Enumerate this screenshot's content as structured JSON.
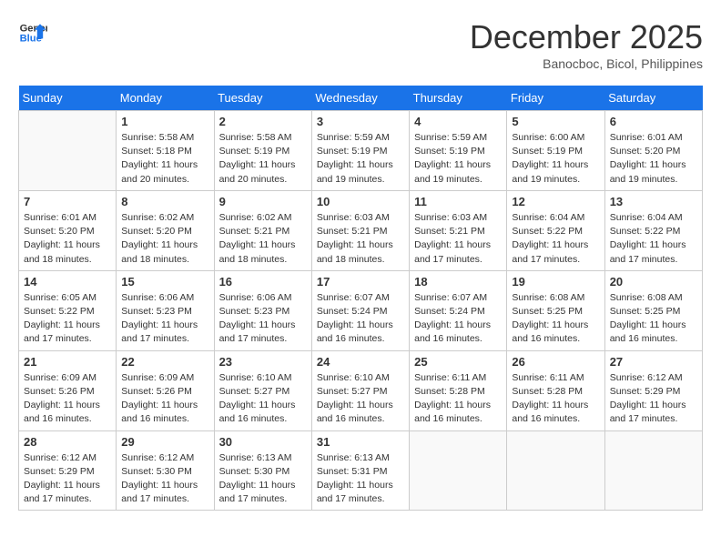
{
  "header": {
    "logo_line1": "General",
    "logo_line2": "Blue",
    "month": "December 2025",
    "location": "Banocboc, Bicol, Philippines"
  },
  "days_of_week": [
    "Sunday",
    "Monday",
    "Tuesday",
    "Wednesday",
    "Thursday",
    "Friday",
    "Saturday"
  ],
  "weeks": [
    [
      {
        "day": "",
        "info": ""
      },
      {
        "day": "1",
        "info": "Sunrise: 5:58 AM\nSunset: 5:18 PM\nDaylight: 11 hours\nand 20 minutes."
      },
      {
        "day": "2",
        "info": "Sunrise: 5:58 AM\nSunset: 5:19 PM\nDaylight: 11 hours\nand 20 minutes."
      },
      {
        "day": "3",
        "info": "Sunrise: 5:59 AM\nSunset: 5:19 PM\nDaylight: 11 hours\nand 19 minutes."
      },
      {
        "day": "4",
        "info": "Sunrise: 5:59 AM\nSunset: 5:19 PM\nDaylight: 11 hours\nand 19 minutes."
      },
      {
        "day": "5",
        "info": "Sunrise: 6:00 AM\nSunset: 5:19 PM\nDaylight: 11 hours\nand 19 minutes."
      },
      {
        "day": "6",
        "info": "Sunrise: 6:01 AM\nSunset: 5:20 PM\nDaylight: 11 hours\nand 19 minutes."
      }
    ],
    [
      {
        "day": "7",
        "info": "Sunrise: 6:01 AM\nSunset: 5:20 PM\nDaylight: 11 hours\nand 18 minutes."
      },
      {
        "day": "8",
        "info": "Sunrise: 6:02 AM\nSunset: 5:20 PM\nDaylight: 11 hours\nand 18 minutes."
      },
      {
        "day": "9",
        "info": "Sunrise: 6:02 AM\nSunset: 5:21 PM\nDaylight: 11 hours\nand 18 minutes."
      },
      {
        "day": "10",
        "info": "Sunrise: 6:03 AM\nSunset: 5:21 PM\nDaylight: 11 hours\nand 18 minutes."
      },
      {
        "day": "11",
        "info": "Sunrise: 6:03 AM\nSunset: 5:21 PM\nDaylight: 11 hours\nand 17 minutes."
      },
      {
        "day": "12",
        "info": "Sunrise: 6:04 AM\nSunset: 5:22 PM\nDaylight: 11 hours\nand 17 minutes."
      },
      {
        "day": "13",
        "info": "Sunrise: 6:04 AM\nSunset: 5:22 PM\nDaylight: 11 hours\nand 17 minutes."
      }
    ],
    [
      {
        "day": "14",
        "info": "Sunrise: 6:05 AM\nSunset: 5:22 PM\nDaylight: 11 hours\nand 17 minutes."
      },
      {
        "day": "15",
        "info": "Sunrise: 6:06 AM\nSunset: 5:23 PM\nDaylight: 11 hours\nand 17 minutes."
      },
      {
        "day": "16",
        "info": "Sunrise: 6:06 AM\nSunset: 5:23 PM\nDaylight: 11 hours\nand 17 minutes."
      },
      {
        "day": "17",
        "info": "Sunrise: 6:07 AM\nSunset: 5:24 PM\nDaylight: 11 hours\nand 16 minutes."
      },
      {
        "day": "18",
        "info": "Sunrise: 6:07 AM\nSunset: 5:24 PM\nDaylight: 11 hours\nand 16 minutes."
      },
      {
        "day": "19",
        "info": "Sunrise: 6:08 AM\nSunset: 5:25 PM\nDaylight: 11 hours\nand 16 minutes."
      },
      {
        "day": "20",
        "info": "Sunrise: 6:08 AM\nSunset: 5:25 PM\nDaylight: 11 hours\nand 16 minutes."
      }
    ],
    [
      {
        "day": "21",
        "info": "Sunrise: 6:09 AM\nSunset: 5:26 PM\nDaylight: 11 hours\nand 16 minutes."
      },
      {
        "day": "22",
        "info": "Sunrise: 6:09 AM\nSunset: 5:26 PM\nDaylight: 11 hours\nand 16 minutes."
      },
      {
        "day": "23",
        "info": "Sunrise: 6:10 AM\nSunset: 5:27 PM\nDaylight: 11 hours\nand 16 minutes."
      },
      {
        "day": "24",
        "info": "Sunrise: 6:10 AM\nSunset: 5:27 PM\nDaylight: 11 hours\nand 16 minutes."
      },
      {
        "day": "25",
        "info": "Sunrise: 6:11 AM\nSunset: 5:28 PM\nDaylight: 11 hours\nand 16 minutes."
      },
      {
        "day": "26",
        "info": "Sunrise: 6:11 AM\nSunset: 5:28 PM\nDaylight: 11 hours\nand 16 minutes."
      },
      {
        "day": "27",
        "info": "Sunrise: 6:12 AM\nSunset: 5:29 PM\nDaylight: 11 hours\nand 17 minutes."
      }
    ],
    [
      {
        "day": "28",
        "info": "Sunrise: 6:12 AM\nSunset: 5:29 PM\nDaylight: 11 hours\nand 17 minutes."
      },
      {
        "day": "29",
        "info": "Sunrise: 6:12 AM\nSunset: 5:30 PM\nDaylight: 11 hours\nand 17 minutes."
      },
      {
        "day": "30",
        "info": "Sunrise: 6:13 AM\nSunset: 5:30 PM\nDaylight: 11 hours\nand 17 minutes."
      },
      {
        "day": "31",
        "info": "Sunrise: 6:13 AM\nSunset: 5:31 PM\nDaylight: 11 hours\nand 17 minutes."
      },
      {
        "day": "",
        "info": ""
      },
      {
        "day": "",
        "info": ""
      },
      {
        "day": "",
        "info": ""
      }
    ]
  ]
}
